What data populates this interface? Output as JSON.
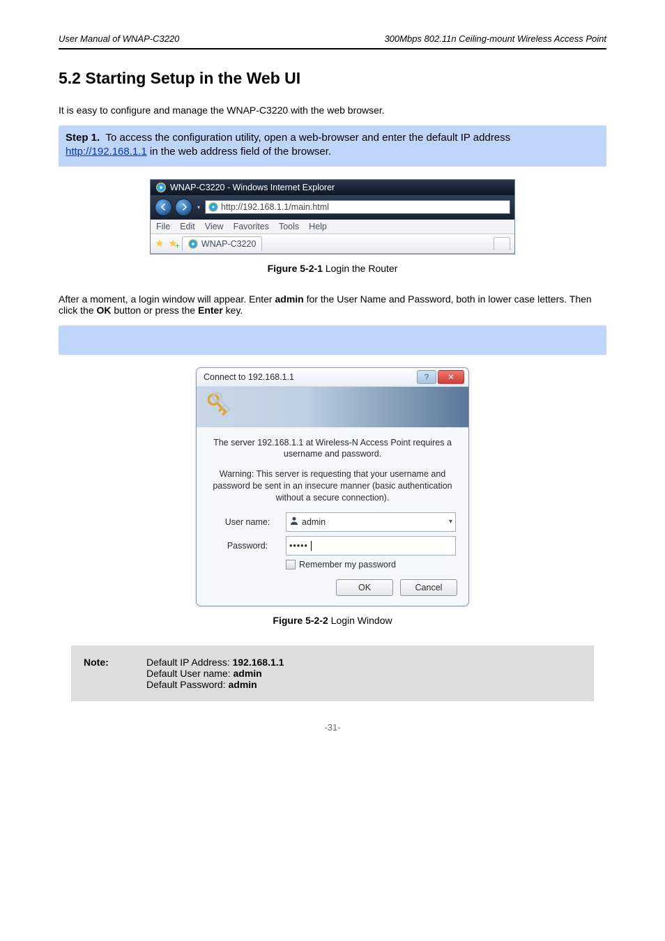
{
  "header": {
    "left_italic": "User Manual of WNAP-C3220",
    "right_italic": "300Mbps 802.11n Ceiling-mount Wireless Access Point"
  },
  "section": {
    "heading": "5.2 Starting Setup in the Web UI",
    "intro": "It is easy to configure and manage the WNAP-C3220 with the web browser."
  },
  "step1": {
    "label": "Step 1.",
    "text_before_ip": "To access the configuration utility, open a web-browser and enter the default IP address",
    "ip_link": "http://192.168.1.1",
    "text_after_ip": " in the web address field of the browser."
  },
  "browser": {
    "window_title": "WNAP-C3220 - Windows Internet Explorer",
    "url": "http://192.168.1.1/main.html",
    "menu": [
      "File",
      "Edit",
      "View",
      "Favorites",
      "Tools",
      "Help"
    ],
    "tab_title": "WNAP-C3220"
  },
  "figure1": {
    "num": "Figure 5-2-1",
    "caption": " Login the Router"
  },
  "between_text": "After a moment, a login window will appear. Enter admin for the User Name and Password, both in lower case letters. Then click the OK button or press the Enter key.",
  "figure2": {
    "num": "Figure 5-2-2",
    "caption": " Login Window"
  },
  "dialog": {
    "title": "Connect to 192.168.1.1",
    "para1": "The server 192.168.1.1 at Wireless-N Access Point requires a username and password.",
    "para2": "Warning: This server is requesting that your username and password be sent in an insecure manner (basic authentication without a secure connection).",
    "username_label": "User name:",
    "username_value": "admin",
    "password_label": "Password:",
    "password_value": "•••••",
    "remember_label": "Remember my password",
    "ok_button": "OK",
    "cancel_button": "Cancel"
  },
  "note": {
    "label": "Note:",
    "line1": "Default IP Address: 192.168.1.1",
    "line2": "Default User name: admin",
    "line3": "Default Password: admin"
  },
  "page_number": "-31-"
}
